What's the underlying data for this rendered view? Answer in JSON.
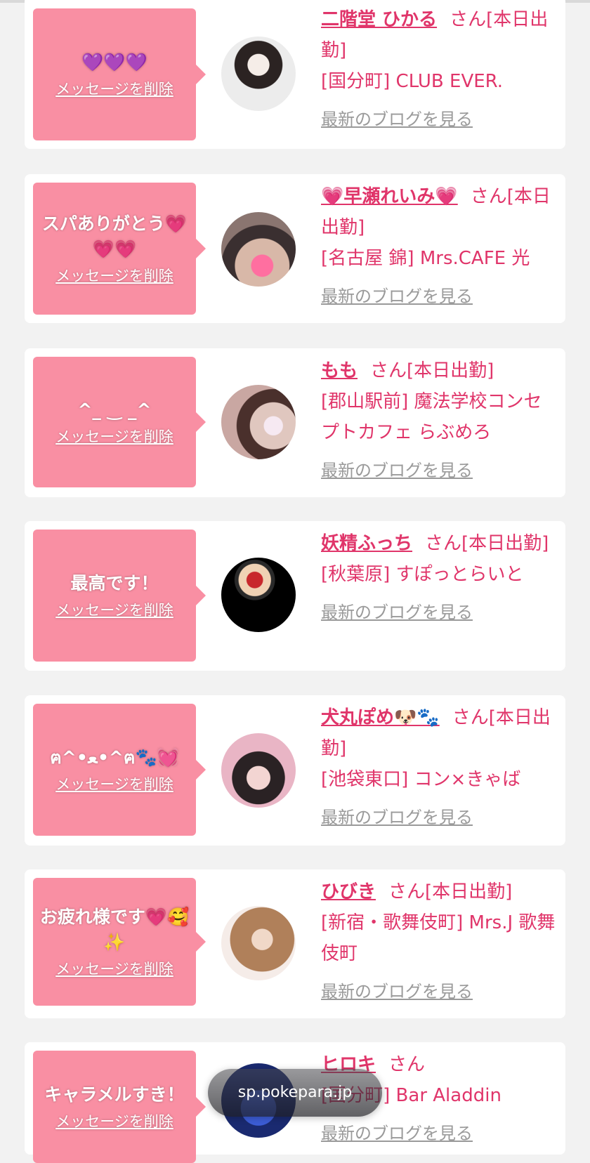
{
  "delete_label": "メッセージを削除",
  "blog_label": "最新のブログを見る",
  "san_suffix": "さん",
  "url_pill": "sp.pokepara.jp",
  "colors": {
    "bubble": "#f98fa3",
    "accent": "#e0356a",
    "link_gray": "#9a9a9a",
    "bg": "#f2f2f2"
  },
  "cards": [
    {
      "message": "💜💜💜",
      "name": "二階堂 ひかる",
      "status": "[本日出勤]",
      "shop": "[国分町] CLUB EVER."
    },
    {
      "message": "スパありがとう💗💗💗",
      "name": "💗早瀬れいみ💗",
      "status": "[本日出勤]",
      "shop": "[名古屋 錦] Mrs.CAFE 光"
    },
    {
      "message": "^_ ‿ _^",
      "name": "もも",
      "status": "[本日出勤]",
      "shop": "[郡山駅前] 魔法学校コンセプトカフェ らぶめろ"
    },
    {
      "message": "最高です！",
      "name": "妖精ふっち",
      "status": "[本日出勤]",
      "shop": "[秋葉原] すぽっとらいと"
    },
    {
      "message": "ฅ^•ﻌ•^ฅ🐾💓",
      "name": "犬丸ぽめ🐶🐾",
      "status": "[本日出勤]",
      "shop": "[池袋東口] コン×きゃば"
    },
    {
      "message": "お疲れ様です💗🥰✨",
      "name": "ひびき",
      "status": "[本日出勤]",
      "shop": "[新宿・歌舞伎町] Mrs.J 歌舞伎町"
    },
    {
      "message": "キャラメルすき！",
      "name": "ヒロキ",
      "status": "",
      "shop": "[国分町] Bar Aladdin"
    }
  ]
}
